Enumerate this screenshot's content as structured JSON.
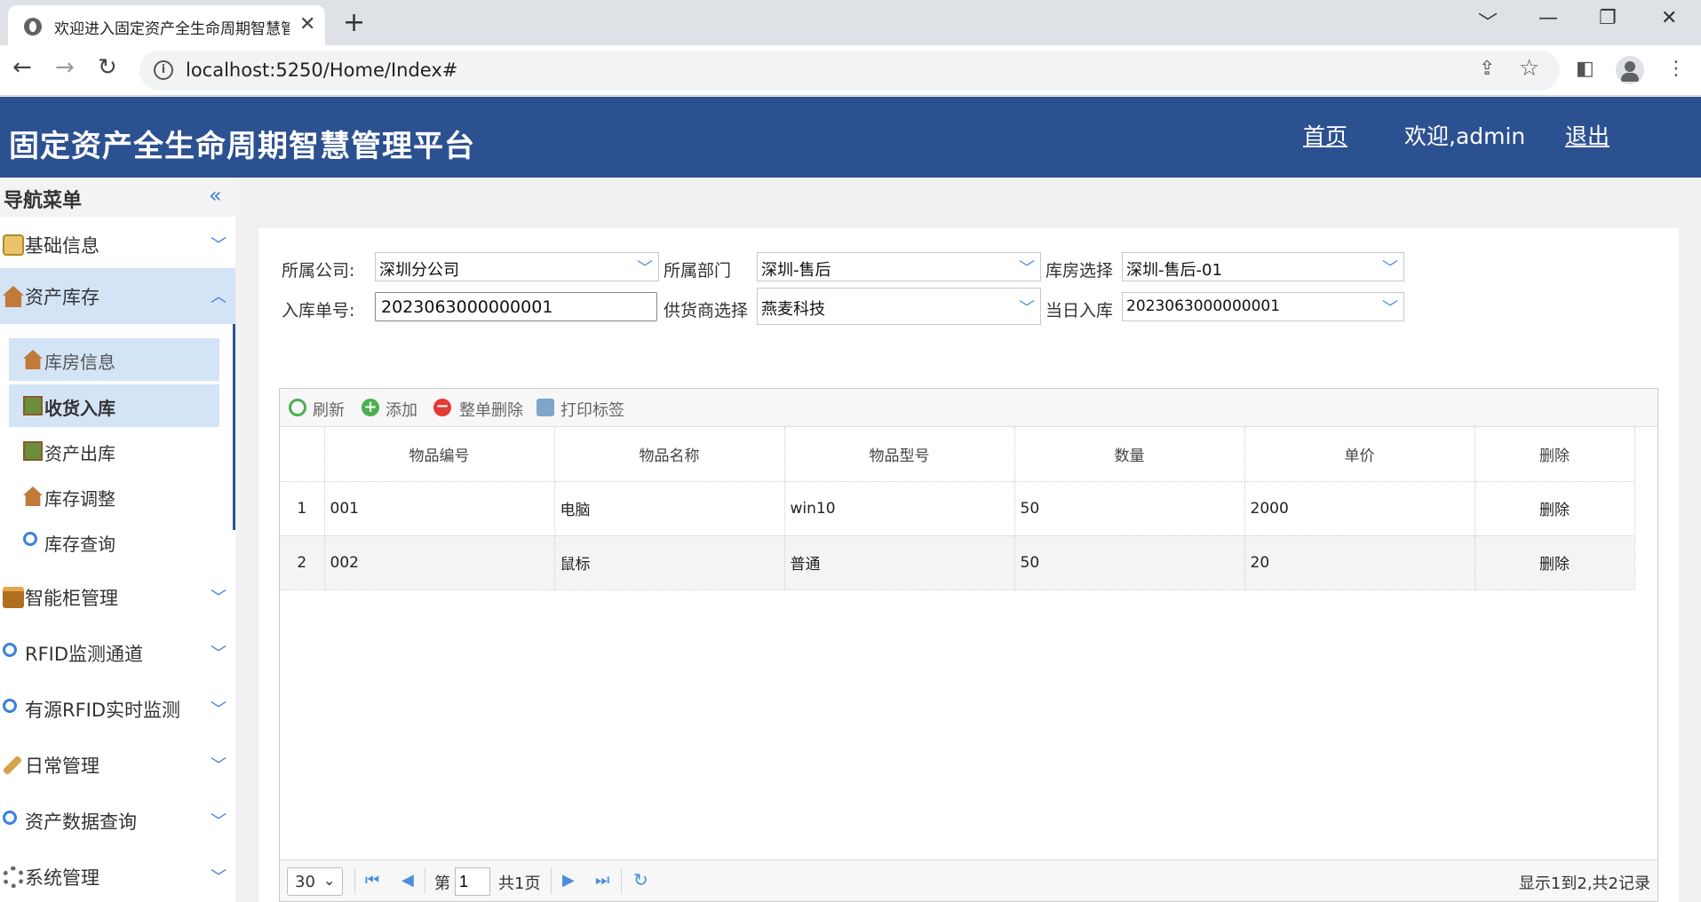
{
  "browser": {
    "tab_title": "欢迎进入固定资产全生命周期智慧管理平台",
    "tab_close": "✕",
    "new_tab": "+",
    "url": "localhost:5250/Home/Index#",
    "window_controls": [
      "﹀",
      "—",
      "❐",
      "✕"
    ]
  },
  "header": {
    "title": "固定资产全生命周期智慧管理平台",
    "home_link": "首页",
    "welcome": "欢迎,admin",
    "logout_link": "退出"
  },
  "sidebar": {
    "title": "导航菜单",
    "collapse_icon": "«",
    "menus": [
      {
        "label": "基础信息",
        "icon": "database-icon",
        "expanded": false
      },
      {
        "label": "资产库存",
        "icon": "warehouse-icon",
        "expanded": true
      },
      {
        "label": "智能柜管理",
        "icon": "cabinet-icon",
        "expanded": false
      },
      {
        "label": "RFID监测通道",
        "icon": "magnifier-icon",
        "expanded": false
      },
      {
        "label": "有源RFID实时监测",
        "icon": "magnifier-icon",
        "expanded": false
      },
      {
        "label": "日常管理",
        "icon": "wrench-icon",
        "expanded": false
      },
      {
        "label": "资产数据查询",
        "icon": "magnifier-icon",
        "expanded": false
      },
      {
        "label": "系统管理",
        "icon": "gear-icon",
        "expanded": false
      }
    ],
    "submenu": [
      {
        "label": "库房信息",
        "icon": "warehouse-icon"
      },
      {
        "label": "收货入库",
        "icon": "goods-icon"
      },
      {
        "label": "资产出库",
        "icon": "goods-icon"
      },
      {
        "label": "库存调整",
        "icon": "warehouse-icon"
      },
      {
        "label": "库存查询",
        "icon": "magnifier-icon"
      }
    ]
  },
  "form": {
    "company_label": "所属公司:",
    "company_value": "深圳分公司",
    "dept_label": "所属部门",
    "dept_value": "深圳-售后",
    "warehouse_label": "库房选择",
    "warehouse_value": "深圳-售后-01",
    "order_label": "入库单号:",
    "order_value": "2023063000000001",
    "supplier_label": "供货商选择",
    "supplier_value": "燕麦科技",
    "today_label": "当日入库",
    "today_value": "2023063000000001"
  },
  "grid": {
    "toolbar": {
      "refresh": "刷新",
      "add": "添加",
      "delete_all": "整单删除",
      "print": "打印标签"
    },
    "columns": [
      "物品编号",
      "物品名称",
      "物品型号",
      "数量",
      "单价",
      "删除"
    ],
    "rows": [
      {
        "n": "1",
        "code": "001",
        "name": "电脑",
        "model": "win10",
        "qty": "50",
        "price": "2000",
        "del": "删除"
      },
      {
        "n": "2",
        "code": "002",
        "name": "鼠标",
        "model": "普通",
        "qty": "50",
        "price": "20",
        "del": "删除"
      }
    ],
    "pager": {
      "page_size": "30",
      "page_prefix": "第",
      "page_value": "1",
      "total_pages": "共1页",
      "summary": "显示1到2,共2记录"
    }
  },
  "colors": {
    "header_bg": "#2c5190",
    "menu_selected_bg": "#d3e4f7",
    "accent": "#4a90d9"
  }
}
